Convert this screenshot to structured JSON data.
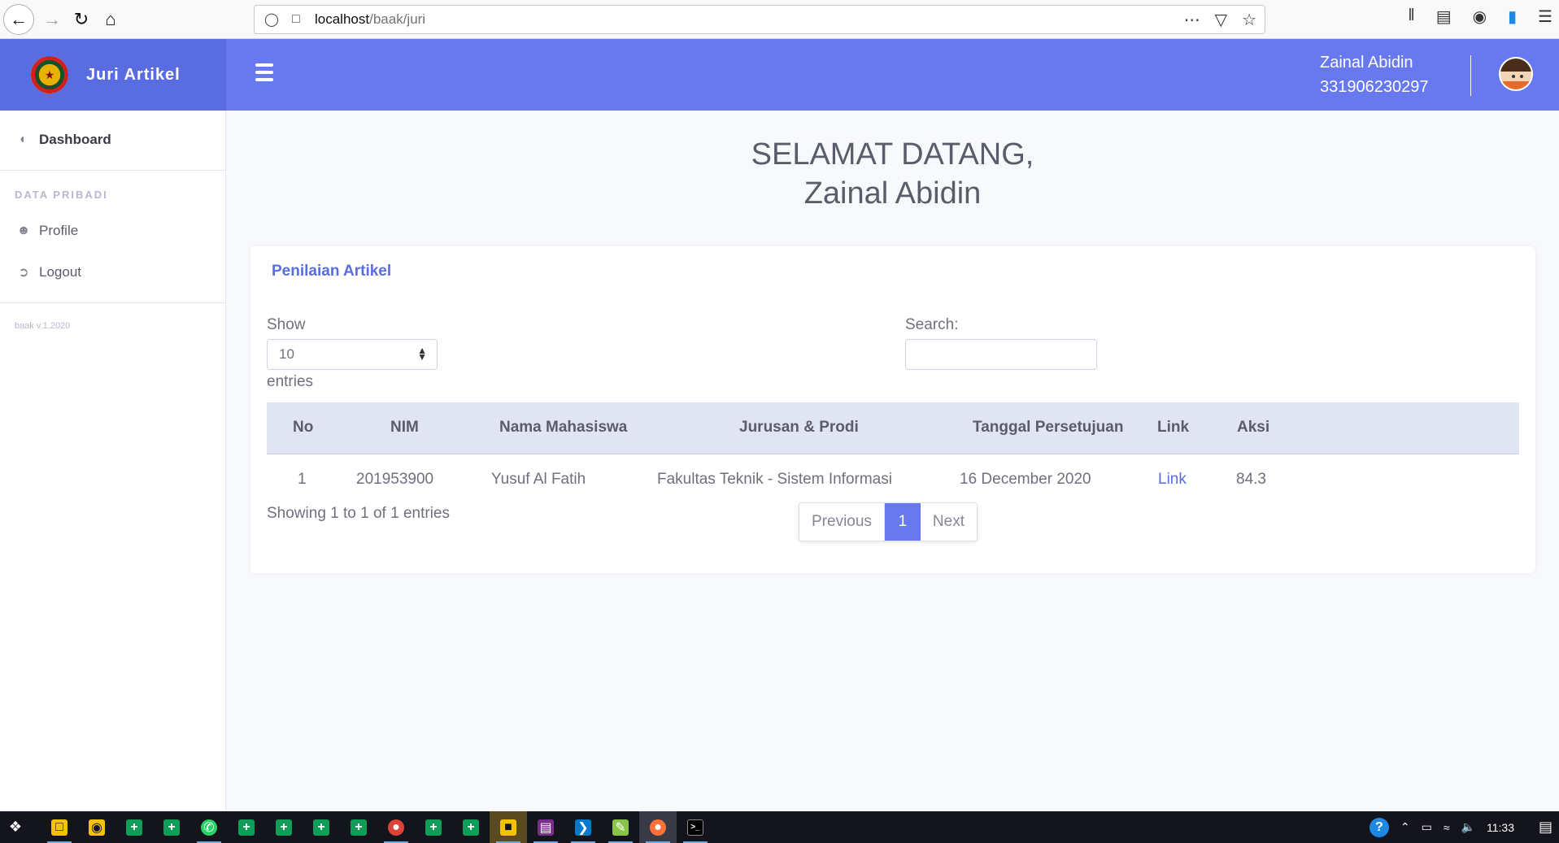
{
  "browser": {
    "url_host": "localhost",
    "url_path": "/baak/juri"
  },
  "brand": {
    "title": "Juri Artikel"
  },
  "user": {
    "name": "Zainal Abidin",
    "id": "331906230297"
  },
  "sidebar": {
    "dashboard": "Dashboard",
    "heading": "DATA PRIBADI",
    "profile": "Profile",
    "logout": "Logout",
    "version": "baak v.1.2020"
  },
  "main": {
    "welcome_line1": "SELAMAT DATANG,",
    "welcome_line2": "Zainal Abidin"
  },
  "card": {
    "title": "Penilaian Artikel",
    "show_label": "Show",
    "entries_value": "10",
    "entries_label": "entries",
    "search_label": "Search:",
    "search_value": "",
    "columns": [
      "No",
      "NIM",
      "Nama Mahasiswa",
      "Jurusan & Prodi",
      "Tanggal Persetujuan",
      "Link",
      "Aksi"
    ],
    "rows": [
      {
        "no": "1",
        "nim": "201953900",
        "nama": "Yusuf Al Fatih",
        "jurusan": "Fakultas Teknik - Sistem Informasi",
        "tanggal": "16 December 2020",
        "link": "Link",
        "aksi": "84.3"
      }
    ],
    "showing": "Showing 1 to 1 of 1 entries",
    "pager": {
      "prev": "Previous",
      "page": "1",
      "next": "Next"
    }
  },
  "taskbar": {
    "time": "11:33"
  },
  "colors": {
    "primary": "#6878ee",
    "brand": "#5a6de0",
    "header_row": "#e1e5f3"
  }
}
